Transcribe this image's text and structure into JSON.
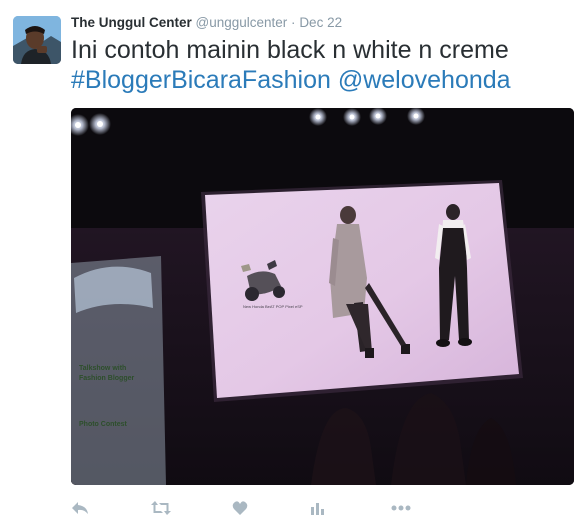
{
  "tweet": {
    "author": {
      "name": "The Unggul Center",
      "handle": "@unggulcenter"
    },
    "separator": "·",
    "date": "Dec 22",
    "text": {
      "plain": "Ini contoh mainin black n white n creme",
      "hashtag": "#BloggerBicaraFashion",
      "mention": "@welovehonda"
    },
    "photo": {
      "screen_caption": "New Honda BeAT POP Pixel eSP",
      "banner_lines": [
        "Talkshow with",
        "Fashion Blogger",
        "Photo Contest"
      ]
    },
    "actions": [
      {
        "name": "reply-icon"
      },
      {
        "name": "retweet-icon"
      },
      {
        "name": "like-icon"
      },
      {
        "name": "more-icon"
      }
    ],
    "colors": {
      "link": "#2b7bb9",
      "muted": "#8899a6",
      "icon": "#aab8c2"
    }
  }
}
